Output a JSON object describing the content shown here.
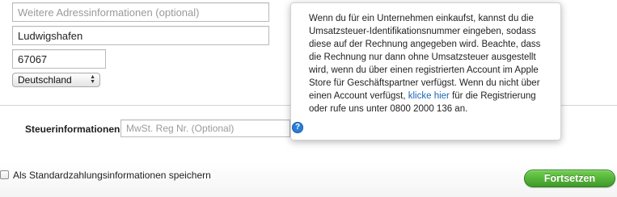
{
  "address": {
    "extra_placeholder": "Weitere Adressinformationen (optional)",
    "extra_value": "",
    "city_value": "Ludwigshafen",
    "zip_value": "67067",
    "country_selected": "Deutschland"
  },
  "tax": {
    "label": "Steuerinformationen",
    "vat_placeholder": "MwSt. Reg Nr. (Optional)",
    "vat_value": ""
  },
  "tooltip": {
    "text_before_link": "Wenn du für ein Unternehmen einkaufst, kannst du die Umsatzsteuer-Identifikationsnummer eingeben, sodass diese auf der Rechnung angegeben wird. Beachte, dass die Rechnung nur dann ohne Umsatzsteuer ausgestellt wird, wenn du über einen registrierten Account im Apple Store für Geschäftspartner verfügst. Wenn du nicht über einen Account verfügst, ",
    "link_text": "klicke hier",
    "text_after_link": " für die Registrierung oder rufe uns unter 0800 2000 136 an.",
    "help_icon_glyph": "?"
  },
  "footer": {
    "save_checkbox_label": "Als Standardzahlungsinformationen speichern",
    "continue_label": "Fortsetzen"
  },
  "colors": {
    "link": "#1c67b8",
    "help_icon": "#2a7ed6",
    "cta_top": "#6fcf4d",
    "cta_bottom": "#3f9a29"
  }
}
